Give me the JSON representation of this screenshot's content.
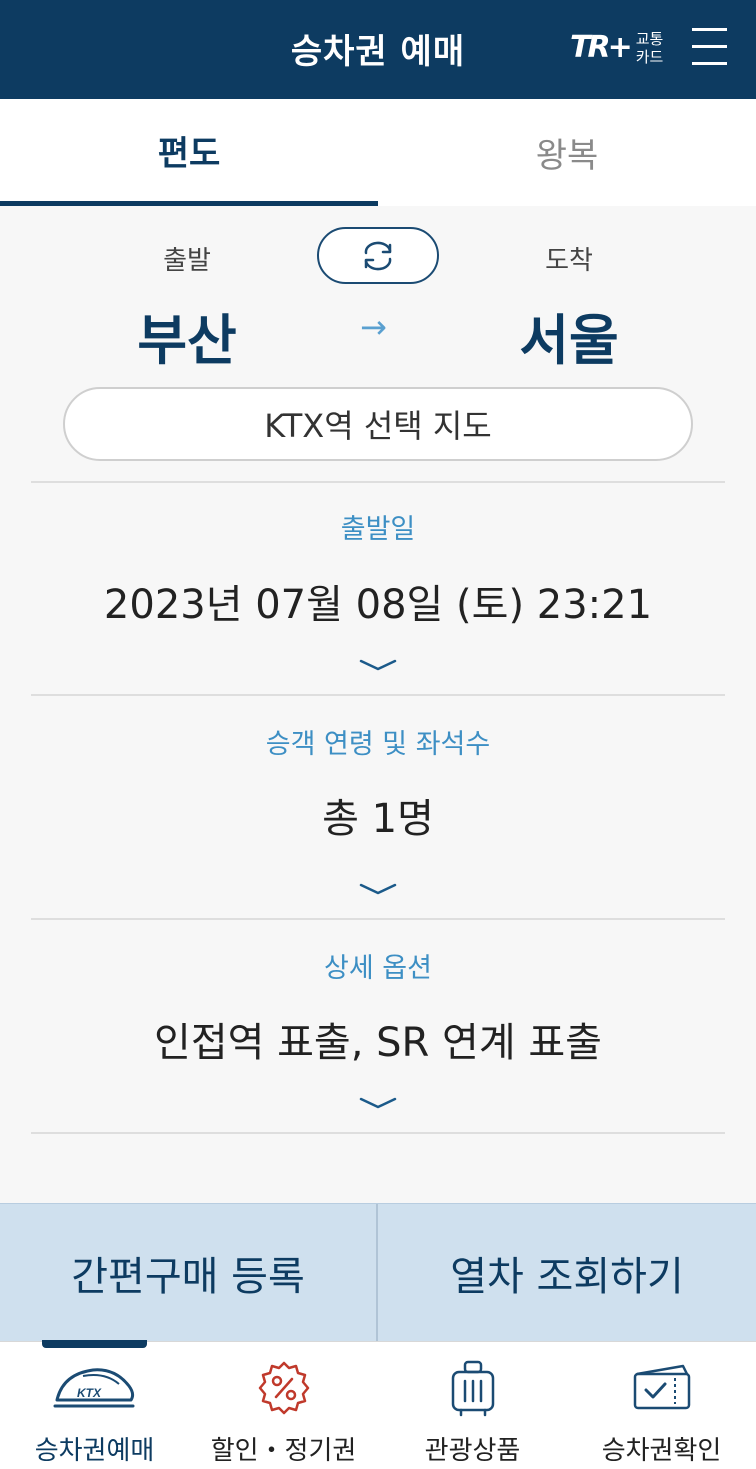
{
  "header": {
    "title": "승차권 예매",
    "card_logo": "TR+",
    "card_text_1": "교통",
    "card_text_2": "카드"
  },
  "tabs": [
    {
      "label": "편도",
      "active": true
    },
    {
      "label": "왕복",
      "active": false
    }
  ],
  "route": {
    "depart_label": "출발",
    "arrive_label": "도착",
    "depart_station": "부산",
    "arrive_station": "서울",
    "arrow": "→",
    "map_button": "KTX역 선택 지도"
  },
  "departure_date": {
    "label": "출발일",
    "value": "2023년 07월 08일 (토) 23:21"
  },
  "passengers": {
    "label": "승객 연령 및 좌석수",
    "value": "총 1명"
  },
  "options": {
    "label": "상세 옵션",
    "value": "인접역 표출, SR 연계 표출"
  },
  "actions": {
    "quick_purchase": "간편구매 등록",
    "search_trains": "열차 조회하기"
  },
  "bottom_nav": [
    {
      "label": "승차권예매",
      "icon": "ktx-train-icon",
      "icon_text": "KTX",
      "active": true
    },
    {
      "label": "할인・정기권",
      "icon": "discount-percent-icon",
      "active": false
    },
    {
      "label": "관광상품",
      "icon": "luggage-icon",
      "active": false
    },
    {
      "label": "승차권확인",
      "icon": "ticket-check-icon",
      "active": false
    }
  ],
  "colors": {
    "primary": "#0d3b61",
    "accent": "#3d8fc4",
    "action_bar": "#cfe0ee",
    "discount_icon": "#c0392b"
  }
}
